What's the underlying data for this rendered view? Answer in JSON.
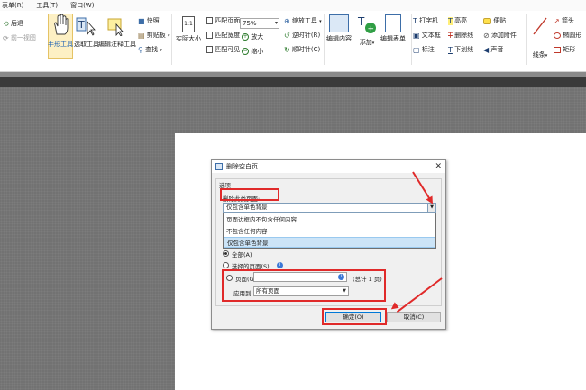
{
  "menubar": {
    "items": [
      "表单(R)",
      "工具(T)",
      "窗口(W)"
    ]
  },
  "ribbon": {
    "back": "后退",
    "forward": "前一视图",
    "hand_tool": "手形工具",
    "select_text": "选取工具",
    "select_annot": "编辑注释工具",
    "snapshot": "快照",
    "clipboard": "剪贴板",
    "find": "查找",
    "actual_size": "实际大小",
    "actual_size_icon": "1:1",
    "fit_page": "匹配页面",
    "fit_width": "匹配宽度",
    "fit_visible": "匹配可见",
    "zoom_value": "75%",
    "zoom_in": "放大",
    "zoom_out": "缩小",
    "zoom_tool": "缩放工具",
    "rotate_ccw": "逆时针(R)",
    "rotate_cw": "顺时针(C)",
    "edit_content": "编辑内容",
    "add": "添加",
    "edit_form": "编辑表单",
    "typewriter": "打字机",
    "text_box": "文本框",
    "callout": "标注",
    "highlight": "高亮",
    "strikeout": "删除线",
    "underline": "下划线",
    "sticky": "便贴",
    "attach": "添加附件",
    "sound": "声音",
    "line": "线条",
    "arrow": "箭头",
    "ellipse": "椭圆形",
    "rect": "矩形"
  },
  "dialog": {
    "title": "删除空白页",
    "close": "✕",
    "group_label": "选项",
    "delete_if_label": "删除此类页面:",
    "combo_value": "仅包含单色背景",
    "options": [
      "页面边框内不包含任何内容",
      "不包含任何内容",
      "仅包含单色背景"
    ],
    "radio_all": "全部(A)",
    "radio_selected": "选择的页面(S)",
    "radio_pages": "页面(G)",
    "pages_total": "(总计 1 页)",
    "apply_to_label": "应用到:",
    "apply_to_value": "所有页面",
    "ok": "确定(O)",
    "cancel": "取消(C)"
  },
  "colors": {
    "annotation_red": "#e02a2a",
    "accent_blue": "#0078d7",
    "dropdown_selected": "#cce4f7"
  }
}
